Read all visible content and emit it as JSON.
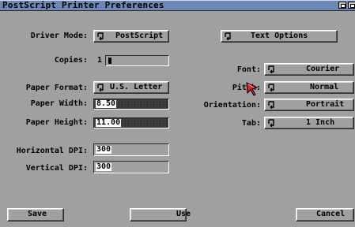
{
  "window": {
    "title": "PostScript Printer Preferences"
  },
  "driver_mode": {
    "label": "Driver Mode:",
    "value": "PostScript"
  },
  "text_options_button": "Text Options",
  "copies": {
    "label": "Copies:",
    "value": "1"
  },
  "paper_format": {
    "label": "Paper Format:",
    "value": "U.S. Letter"
  },
  "paper_width": {
    "label": "Paper Width:",
    "value": "8.50"
  },
  "paper_height": {
    "label": "Paper Height:",
    "value": "11.00"
  },
  "horizontal_dpi": {
    "label": "Horizontal DPI:",
    "value": "300"
  },
  "vertical_dpi": {
    "label": "Vertical DPI:",
    "value": "300"
  },
  "font": {
    "label": "Font:",
    "value": "Courier"
  },
  "pitch": {
    "label": "Pitch:",
    "value": "Normal"
  },
  "orientation": {
    "label": "Orientation:",
    "value": "Portrait"
  },
  "tab": {
    "label": "Tab:",
    "value": "1 Inch"
  },
  "buttons": {
    "save": "Save",
    "use": "Use",
    "cancel": "Cancel"
  },
  "icons": {
    "cycle": "cycle-icon",
    "depth": "depth-gadget-icon",
    "pointer": "mouse-pointer-icon"
  },
  "colors": {
    "background": "#a0a0a0",
    "titlebar": "#6d88b6",
    "pointer": "#e02020"
  }
}
